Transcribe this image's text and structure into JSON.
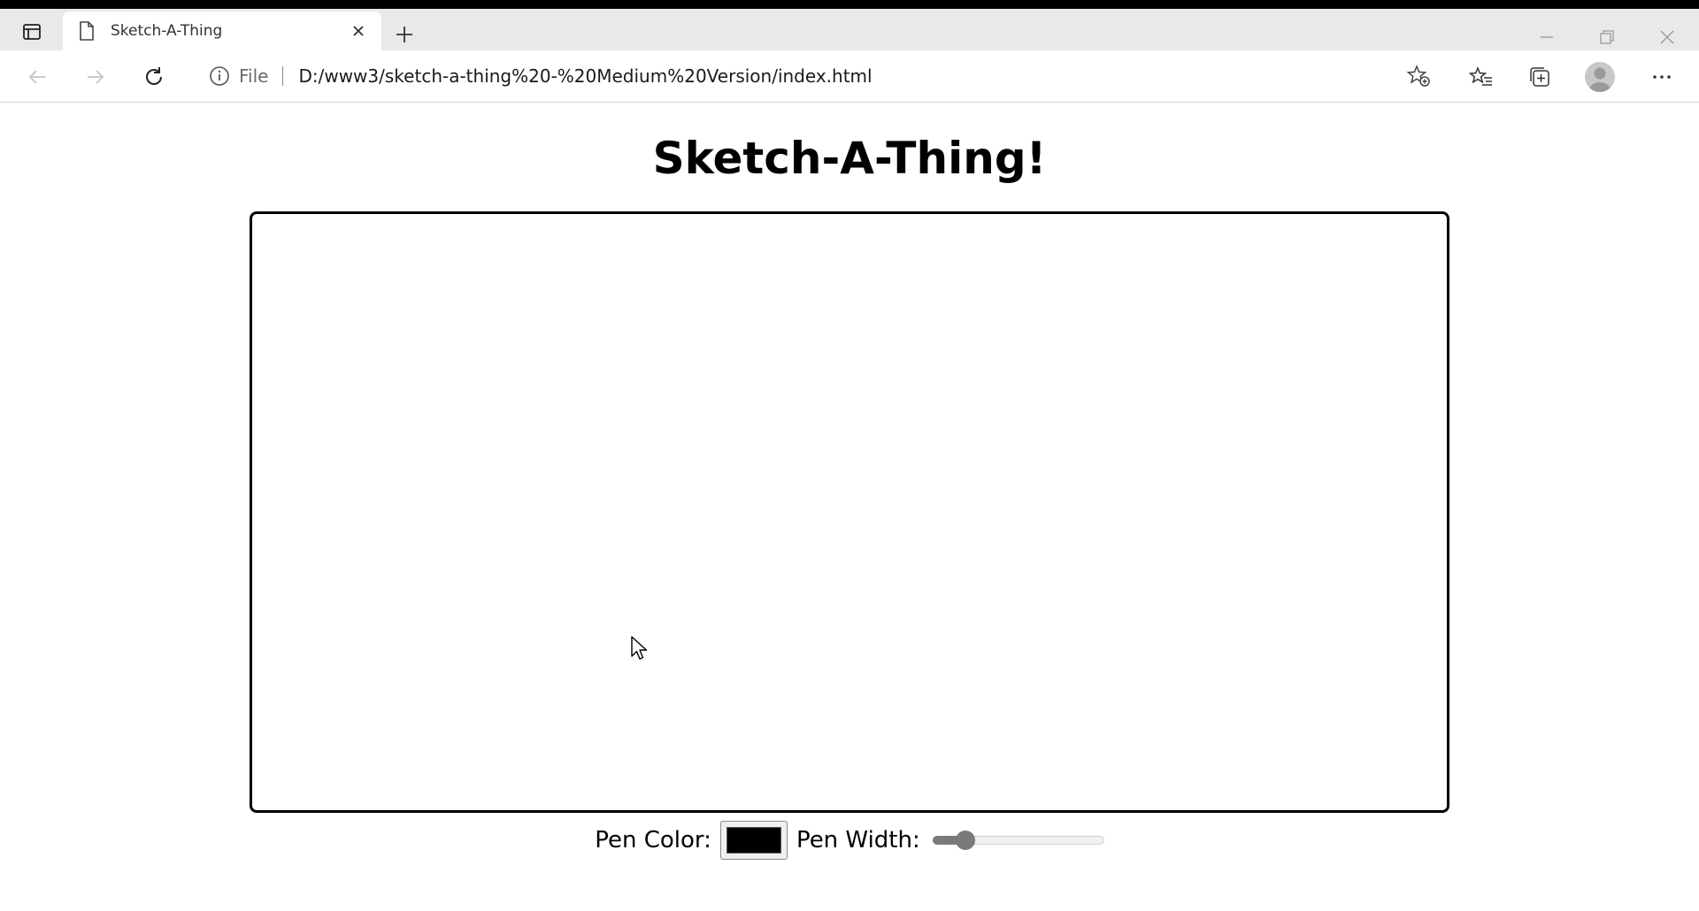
{
  "browser": {
    "tab": {
      "title": "Sketch-A-Thing",
      "close_icon": "close-icon",
      "page_icon": "page-icon"
    },
    "address": {
      "scheme": "File",
      "url": "D:/www3/sketch-a-thing%20-%20Medium%20Version/index.html"
    },
    "icons": {
      "tab_actions": "tab-actions-icon",
      "new_tab": "plus-icon",
      "back": "arrow-left-icon",
      "forward": "arrow-right-icon",
      "reload": "reload-icon",
      "info": "info-icon",
      "add_favorite": "star-add-icon",
      "favorites": "favorites-icon",
      "collections": "collections-icon",
      "profile": "profile-icon",
      "menu": "more-icon",
      "minimize": "minimize-icon",
      "maximize": "restore-icon",
      "close_window": "close-icon"
    }
  },
  "page": {
    "title": "Sketch-A-Thing!",
    "controls": {
      "pen_color_label": "Pen Color:",
      "pen_color_value": "#000000",
      "pen_width_label": "Pen Width:",
      "pen_width_level": 0.15
    }
  },
  "colors": {
    "tabbar_bg": "#e9e9e9",
    "canvas_border": "#000000",
    "slider_accent": "#7a7a7a"
  }
}
